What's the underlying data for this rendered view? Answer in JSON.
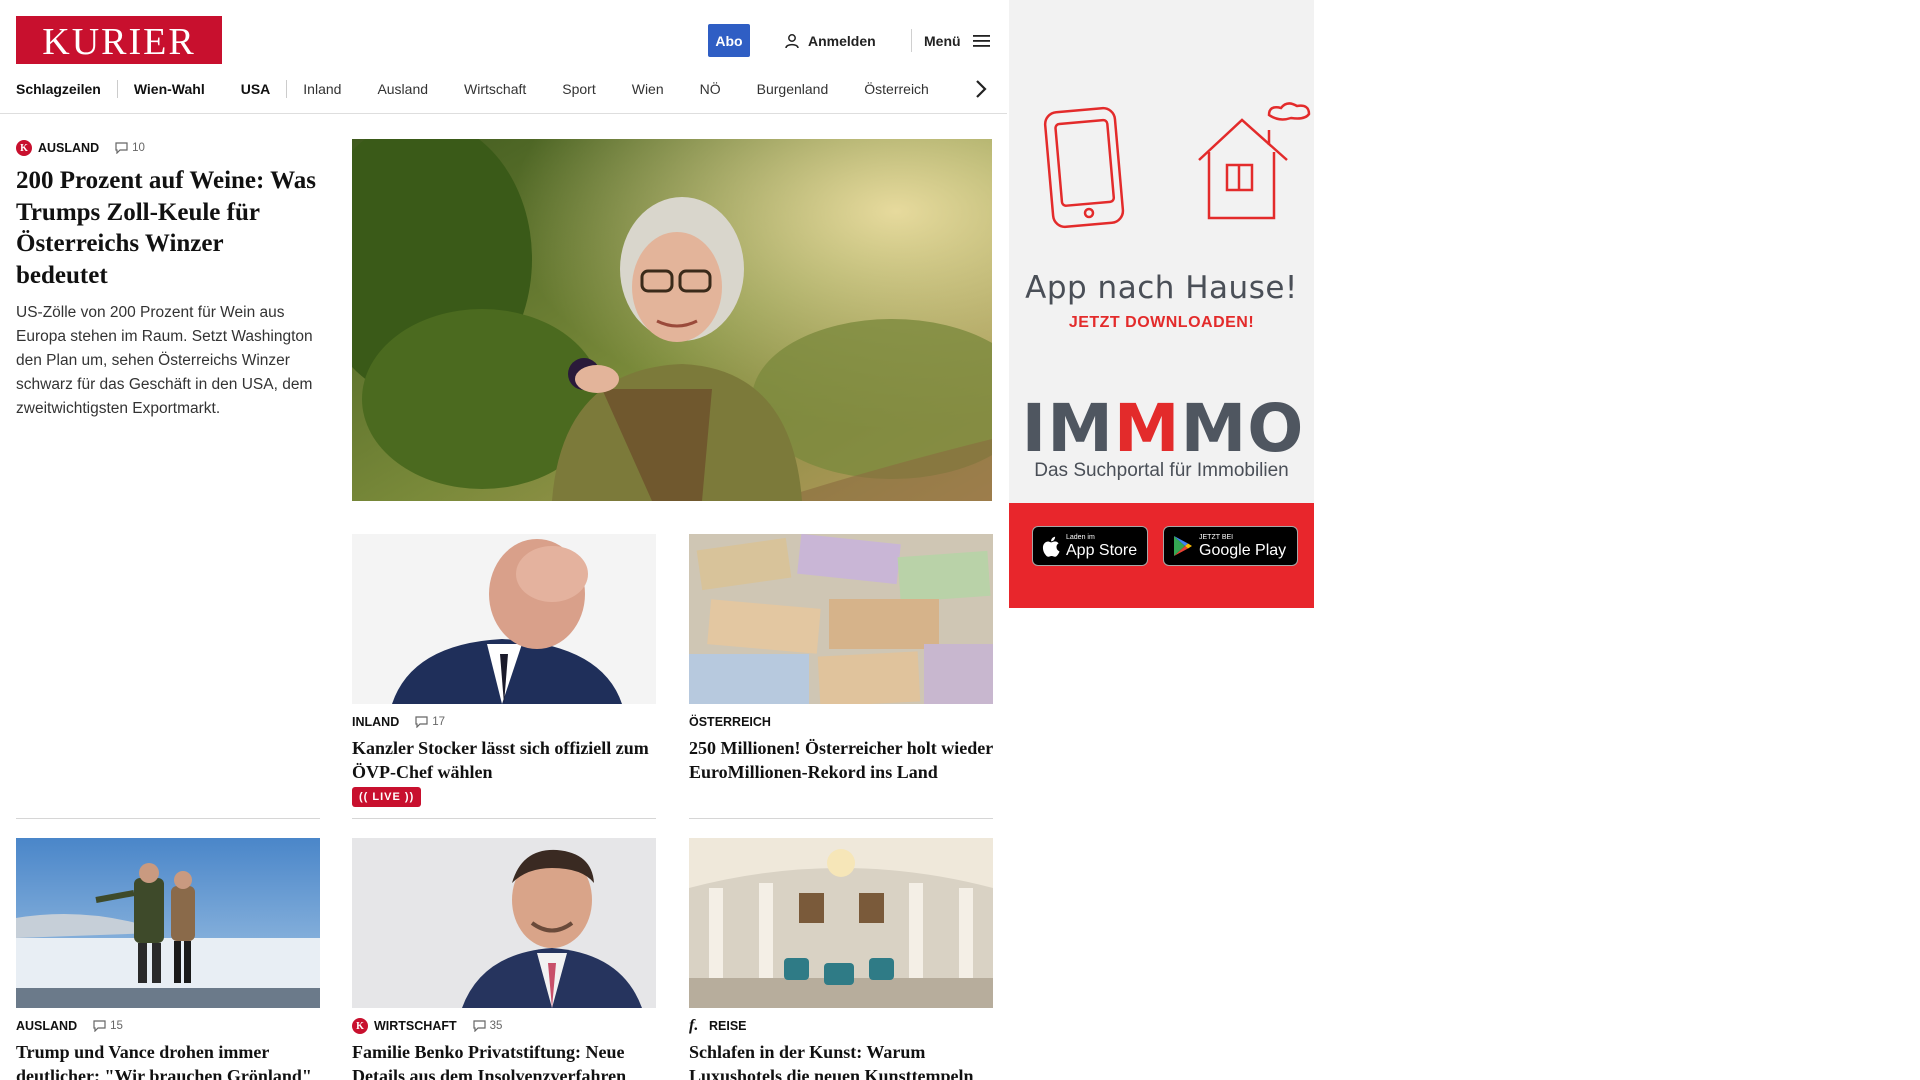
{
  "header": {
    "logo_text": "KURIER",
    "abo_label": "Abo",
    "login_label": "Anmelden",
    "menu_label": "Menü"
  },
  "nav": {
    "items": [
      "Schlagzeilen",
      "Wien-Wahl",
      "USA",
      "Inland",
      "Ausland",
      "Wirtschaft",
      "Sport",
      "Wien",
      "NÖ",
      "Burgenland",
      "Österreich"
    ]
  },
  "lead": {
    "category": "AUSLAND",
    "comments": "10",
    "headline": "200 Prozent auf Weine: Was Trumps Zoll-Keule für Österreichs Winzer bedeutet",
    "teaser": "US-Zölle von 200 Prozent für Wein aus Europa stehen im Raum. Setzt Washington den Plan um, sehen Österreichs Winzer schwarz für das Geschäft in den USA, dem zweitwichtigsten Exportmarkt."
  },
  "articles": [
    {
      "category": "INLAND",
      "comments": "17",
      "headline": "Kanzler Stocker lässt sich offiziell zum ÖVP-Chef wählen",
      "live": "LIVE"
    },
    {
      "category": "ÖSTERREICH",
      "headline": "250 Millionen! Österreicher holt wieder EuroMillionen-Rekord ins Land"
    },
    {
      "category": "AUSLAND",
      "comments": "15",
      "headline": "Trump und Vance drohen immer deutlicher: \"Wir brauchen Grönland\""
    },
    {
      "category": "WIRTSCHAFT",
      "comments": "35",
      "headline": "Familie Benko Privatstiftung: Neue Details aus dem Insolvenzverfahren"
    },
    {
      "category": "REISE",
      "headline": "Schlafen in der Kunst: Warum Luxushotels die neuen Kunsttempeln sind"
    }
  ],
  "ad": {
    "title": "App nach Hause!",
    "subtitle": "JETZT DOWNLOADEN!",
    "brand_a": "IM",
    "brand_b": "M",
    "brand_c": "MO",
    "tagline": "Das Suchportal für Immobilien",
    "appstore_small": "Laden im",
    "appstore_big": "App Store",
    "googleplay_small": "JETZT BEI",
    "googleplay_big": "Google Play"
  },
  "colors": {
    "brand_red": "#c8102e",
    "abo_blue": "#2f5ec4",
    "ad_red": "#e8262c",
    "ad_grey": "#f2f2f2"
  }
}
